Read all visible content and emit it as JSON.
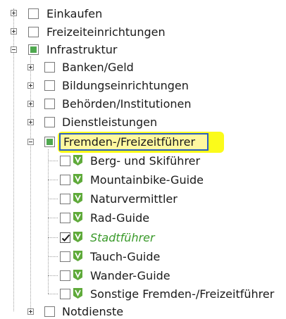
{
  "tree": {
    "root_items": [
      {
        "label": "Einkaufen"
      },
      {
        "label": "Freizeiteinrichtungen"
      },
      {
        "label": "Infrastruktur"
      }
    ],
    "infra_children": [
      {
        "label": "Banken/Geld"
      },
      {
        "label": "Bildungseinrichtungen"
      },
      {
        "label": "Behörden/Institutionen"
      },
      {
        "label": "Dienstleistungen"
      },
      {
        "label": "Fremden-/Freizeitführer"
      },
      {
        "label": "Notdienste"
      }
    ],
    "guide_children": [
      {
        "label": "Berg- und Skiführer"
      },
      {
        "label": "Mountainbike-Guide"
      },
      {
        "label": "Naturvermittler"
      },
      {
        "label": "Rad-Guide"
      },
      {
        "label": "Stadtführer",
        "checked": true
      },
      {
        "label": "Tauch-Guide"
      },
      {
        "label": "Wander-Guide"
      },
      {
        "label": "Sonstige Fremden-/Freizeitführer"
      }
    ]
  },
  "colors": {
    "highlight_yellow": "#fbfb1a",
    "selection_border": "#2b5fbf",
    "checked_label": "#3a9a2a",
    "partial_fill": "#4fa84f",
    "category_icon": "#5faa3a"
  },
  "icons": {
    "expander_plus": "plus-box-icon",
    "expander_minus": "minus-box-icon",
    "category_icon": "green-v-badge-icon",
    "checkmark": "check-icon"
  }
}
